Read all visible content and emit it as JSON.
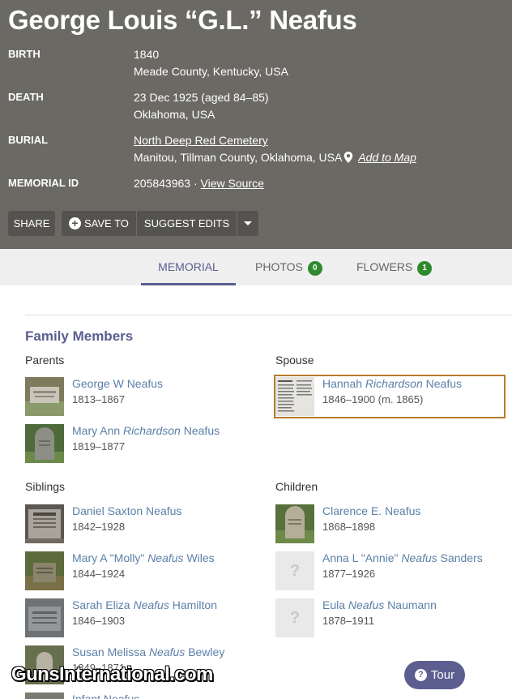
{
  "memorial": {
    "name": "George Louis “G.L.” Neafus",
    "birth_label": "BIRTH",
    "birth_date": "1840",
    "birth_place": "Meade County, Kentucky, USA",
    "death_label": "DEATH",
    "death_date": "23 Dec 1925 (aged 84–85)",
    "death_place": "Oklahoma, USA",
    "burial_label": "BURIAL",
    "burial_cemetery": "North Deep Red Cemetery",
    "burial_place": "Manitou, Tillman County, Oklahoma, USA",
    "add_to_map": "Add to Map",
    "memorial_id_label": "MEMORIAL ID",
    "memorial_id": "205843963 ·",
    "view_source": "View Source"
  },
  "actions": {
    "share": "SHARE",
    "save_to": "SAVE TO",
    "suggest_edits": "SUGGEST EDITS"
  },
  "tabs": {
    "memorial": "MEMORIAL",
    "photos": "PHOTOS",
    "photos_count": "0",
    "flowers": "FLOWERS",
    "flowers_count": "1"
  },
  "family": {
    "title": "Family Members",
    "parents_title": "Parents",
    "spouse_title": "Spouse",
    "siblings_title": "Siblings",
    "children_title": "Children",
    "parents": [
      {
        "first": "George W Neafus",
        "maiden": "",
        "last": "",
        "dates": "1813–1867"
      },
      {
        "first": "Mary Ann",
        "maiden": "Richardson",
        "last": "Neafus",
        "dates": "1819–1877"
      }
    ],
    "spouse": [
      {
        "first": "Hannah",
        "maiden": "Richardson",
        "last": "Neafus",
        "dates": "1846–1900 (m. 1865)"
      }
    ],
    "siblings": [
      {
        "first": "Daniel Saxton Neafus",
        "maiden": "",
        "last": "",
        "dates": "1842–1928"
      },
      {
        "first": "Mary A \"Molly\"",
        "maiden": "Neafus",
        "last": "Wiles",
        "dates": "1844–1924"
      },
      {
        "first": "Sarah Eliza",
        "maiden": "Neafus",
        "last": "Hamilton",
        "dates": "1846–1903"
      },
      {
        "first": "Susan Melissa",
        "maiden": "Neafus",
        "last": "Bewley",
        "dates": "1849–1871"
      },
      {
        "first": "Infant Neafus",
        "maiden": "",
        "last": "",
        "dates": ""
      }
    ],
    "children": [
      {
        "first": "Clarence E. Neafus",
        "maiden": "",
        "last": "",
        "dates": "1868–1898"
      },
      {
        "first": "Anna L \"Annie\"",
        "maiden": "Neafus",
        "last": "Sanders",
        "dates": "1877–1926"
      },
      {
        "first": "Eula",
        "maiden": "Neafus",
        "last": "Naumann",
        "dates": "1878–1911"
      }
    ]
  },
  "watermark": "GunsInternational.com",
  "tour": "Tour",
  "icons": {
    "map_pin": "map-pin-icon",
    "plus": "plus-circle-icon",
    "caret": "caret-down-icon",
    "photo_placeholder": "photo-placeholder-icon",
    "help": "help-circle-icon"
  },
  "colors": {
    "header_bg": "#6b6964",
    "accent": "#5b5e8f",
    "link": "#5b80a8",
    "badge": "#2f8a2f",
    "highlight_border": "#b87a2c"
  }
}
